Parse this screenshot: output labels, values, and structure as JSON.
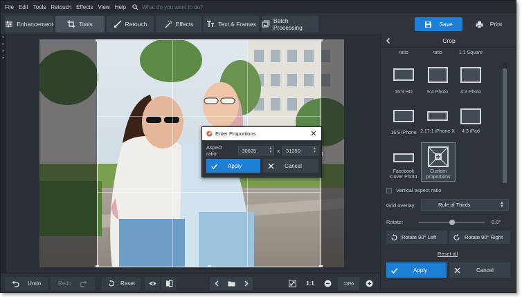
{
  "menu": [
    "File",
    "Edit",
    "Tools",
    "Retouch",
    "Effects",
    "View",
    "Help"
  ],
  "search": {
    "placeholder": "What do you want to do?"
  },
  "tabs": [
    {
      "label": "Enhancement",
      "icon": "sliders-icon"
    },
    {
      "label": "Tools",
      "icon": "crop-icon"
    },
    {
      "label": "Retouch",
      "icon": "brush-icon"
    },
    {
      "label": "Effects",
      "icon": "magic-wand-icon"
    },
    {
      "label": "Text & Frames",
      "icon": "text-icon"
    },
    {
      "label": "Batch Processing",
      "icon": "batch-icon"
    }
  ],
  "actions": {
    "save": "Save",
    "print": "Print"
  },
  "panel": {
    "title": "Crop",
    "presets": [
      {
        "label": "ratio"
      },
      {
        "label": "ratio"
      },
      {
        "label": "1:1 Square"
      },
      {
        "label": "16:9 HD"
      },
      {
        "label": "5:4 Photo"
      },
      {
        "label": "4:3 Photo"
      },
      {
        "label": "16:9 iPhone"
      },
      {
        "label": "2.17:1 iPhone X"
      },
      {
        "label": "4:3 iPad"
      },
      {
        "label": "Facebook Cover Photo"
      },
      {
        "label": "Custom proportions"
      }
    ],
    "vertical_label": "Vertical aspect ratio",
    "grid_overlay_label": "Grid overlay:",
    "grid_overlay_value": "Rule of Thirds",
    "rotate_label": "Rotate:",
    "rotate_value": "0.0°",
    "rotate_slider_fraction": 0.5,
    "rotate_left": "Rotate 90° Left",
    "rotate_right": "Rotate 90° Right",
    "reset_all": "Reset all",
    "apply": "Apply",
    "cancel": "Cancel"
  },
  "dialog": {
    "title": "Enter Proportions",
    "aspect_label": "Aspect ratio:",
    "width_value": "30625",
    "separator": "x",
    "height_value": "31250",
    "apply": "Apply",
    "cancel": "Cancel"
  },
  "bottom": {
    "undo": "Undo",
    "redo": "Redo",
    "reset": "Reset",
    "fit_ratio": "1:1",
    "zoom": "13%"
  },
  "colors": {
    "accent": "#1e7fd6",
    "panel": "#2f343c",
    "background": "#2b3038"
  }
}
